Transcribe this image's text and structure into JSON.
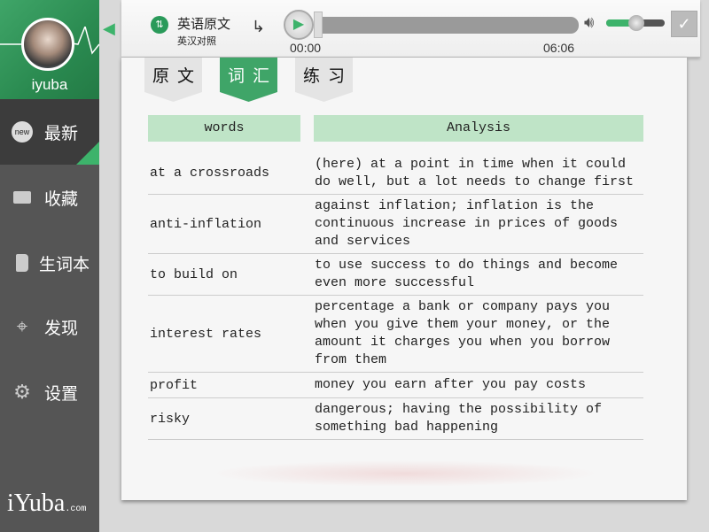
{
  "sidebar": {
    "username": "iyuba",
    "brand": "iYuba",
    "brand_suffix": ".com",
    "items": [
      {
        "label": "最新",
        "icon": "new-badge-icon",
        "active": true,
        "icon_text": "new"
      },
      {
        "label": "收藏",
        "icon": "inbox-icon"
      },
      {
        "label": "生词本",
        "icon": "book-icon"
      },
      {
        "label": "发现",
        "icon": "crosshair-icon"
      },
      {
        "label": "设置",
        "icon": "gear-icon"
      }
    ]
  },
  "player": {
    "lang_primary": "英语原文",
    "lang_secondary": "英汉对照",
    "current_time": "00:00",
    "total_time": "06:06",
    "progress": 0,
    "volume": 0.5
  },
  "tabs": [
    {
      "label": "原文"
    },
    {
      "label": "词汇",
      "active": true
    },
    {
      "label": "练习"
    }
  ],
  "table": {
    "headers": [
      "words",
      "Analysis"
    ],
    "rows": [
      {
        "word": "at a crossroads",
        "analysis": "(here) at a point in time when it could\ndo well, but a lot needs to change first"
      },
      {
        "word": "anti-inflation",
        "analysis": "against inflation; inflation is the\ncontinuous increase in prices of goods\nand services"
      },
      {
        "word": "to build on",
        "analysis": "to use success to do things and become\neven more successful"
      },
      {
        "word": "interest rates",
        "analysis": "percentage a bank or company pays you\nwhen you give them your money, or the\namount it charges you when you borrow\nfrom them"
      },
      {
        "word": "profit",
        "analysis": "money you earn after you pay costs"
      },
      {
        "word": "risky",
        "analysis": "dangerous; having the possibility of\nsomething bad happening"
      }
    ]
  },
  "colors": {
    "accent": "#3fa568",
    "header_bg": "#bfe4c7",
    "sidebar": "#555555"
  }
}
